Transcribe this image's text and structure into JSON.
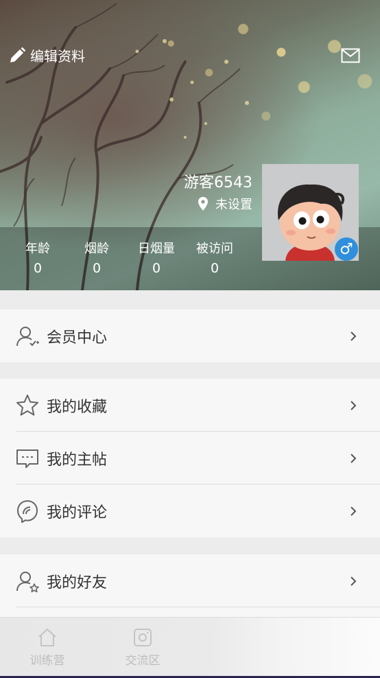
{
  "header": {
    "edit_label": "编辑资料",
    "username": "游客6543",
    "location": "未设置",
    "gender_symbol": "♂",
    "stats": [
      {
        "label": "年龄",
        "value": "0"
      },
      {
        "label": "烟龄",
        "value": "0"
      },
      {
        "label": "日烟量",
        "value": "0"
      },
      {
        "label": "被访问",
        "value": "0"
      }
    ]
  },
  "menu": {
    "member_center": "会员中心",
    "favorites": "我的收藏",
    "my_posts": "我的主帖",
    "my_comments": "我的评论",
    "my_friends": "我的好友"
  },
  "bottom_nav": {
    "tabs": [
      {
        "label": "训练营",
        "icon": "house-icon"
      },
      {
        "label": "交流区",
        "icon": "camera-icon"
      }
    ]
  },
  "colors": {
    "gender_badge": "#2f8fdc",
    "menu_text": "#333333",
    "nav_text": "#bdbdbd",
    "background": "#ececec"
  }
}
